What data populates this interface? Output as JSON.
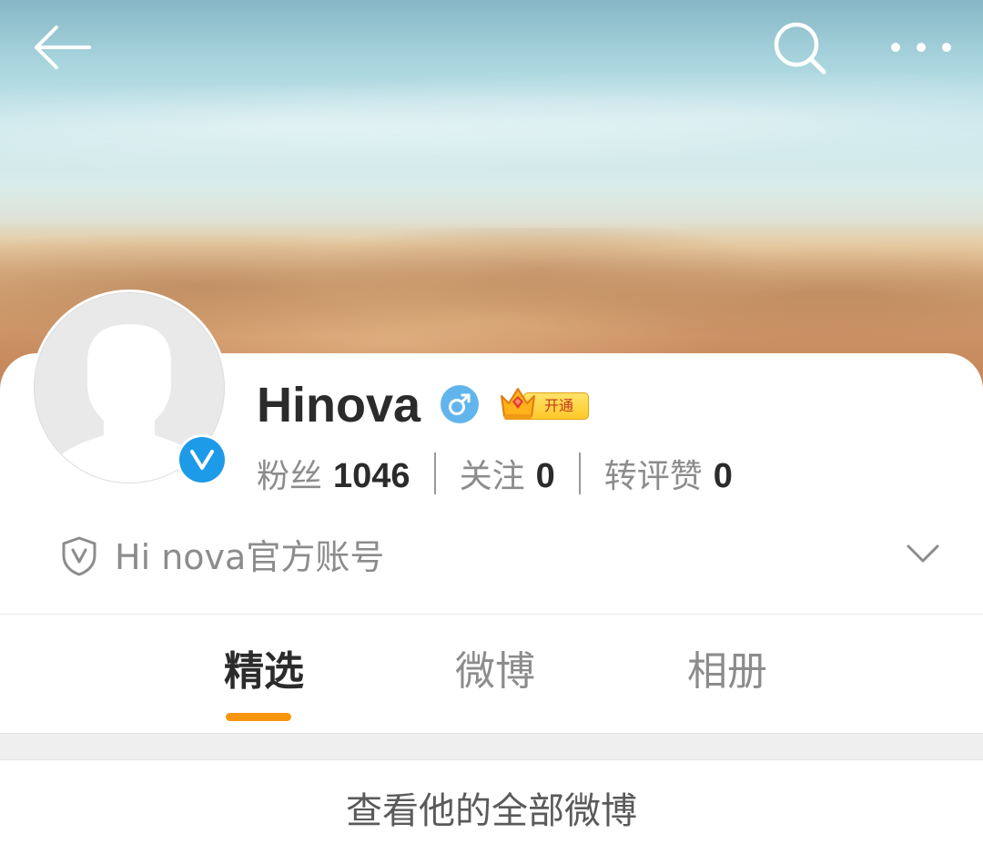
{
  "header": {
    "icons": [
      "back-arrow-icon",
      "search-icon",
      "more-dots-icon"
    ]
  },
  "profile": {
    "name": "Hinova",
    "gender_icon": "male-icon",
    "verified_icon": "verified-v-icon",
    "vip_badge_label": "开通",
    "stats": [
      {
        "label": "粉丝",
        "value": "1046"
      },
      {
        "label": "关注",
        "value": "0"
      },
      {
        "label": "转评赞",
        "value": "0"
      }
    ],
    "official_description": "Hi nova官方账号"
  },
  "tabs": [
    {
      "label": "精选",
      "active": true
    },
    {
      "label": "微博",
      "active": false
    },
    {
      "label": "相册",
      "active": false
    }
  ],
  "view_all_label": "查看他的全部微博",
  "colors": {
    "accent_orange": "#f7960d",
    "verified_blue": "#1e9be8",
    "gender_blue": "#62b5ec",
    "text_dark": "#2b2b2b",
    "text_gray": "#8c8c8c"
  }
}
